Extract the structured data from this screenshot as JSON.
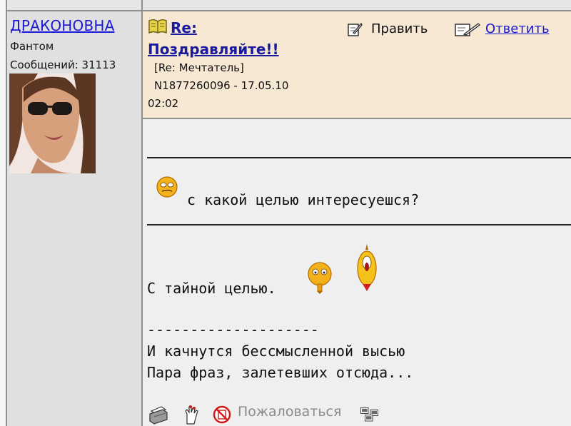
{
  "author": {
    "name": "ДРАКОНОВНА",
    "rank": "Фантом",
    "posts_label": "Сообщений: 31113",
    "avatar_icon": "user-avatar-photo"
  },
  "post": {
    "title_line1": "Re:",
    "title_line2": "Поздравляйте!!",
    "parent": "[Re: Мечтатель]",
    "message_id": "N1877260096 - 17.05.10",
    "time": "02:02",
    "title_icon": "open-book-icon",
    "actions": {
      "edit_label": "Править",
      "reply_label": "Ответить",
      "edit_icon": "pencil-note-icon",
      "reply_icon": "reply-pen-icon"
    }
  },
  "body": {
    "quote": "с какой целью интересуешся?",
    "reply": "С тайной целью.",
    "signature_separator": "--------------------",
    "signature_lines": [
      "И качнутся бессмысленной высью",
      "Пара фраз, залетевших отсюда..."
    ]
  },
  "toolbar": {
    "complain_label": "Пожаловаться",
    "icons": [
      "printer-icon",
      "hand-pointer-icon",
      "complain-icon",
      "network-icon"
    ]
  },
  "colors": {
    "header_bg": "#f7e8d4",
    "left_bg": "#e0e0e0",
    "body_bg": "#efefef",
    "link": "#1a1ad6"
  }
}
